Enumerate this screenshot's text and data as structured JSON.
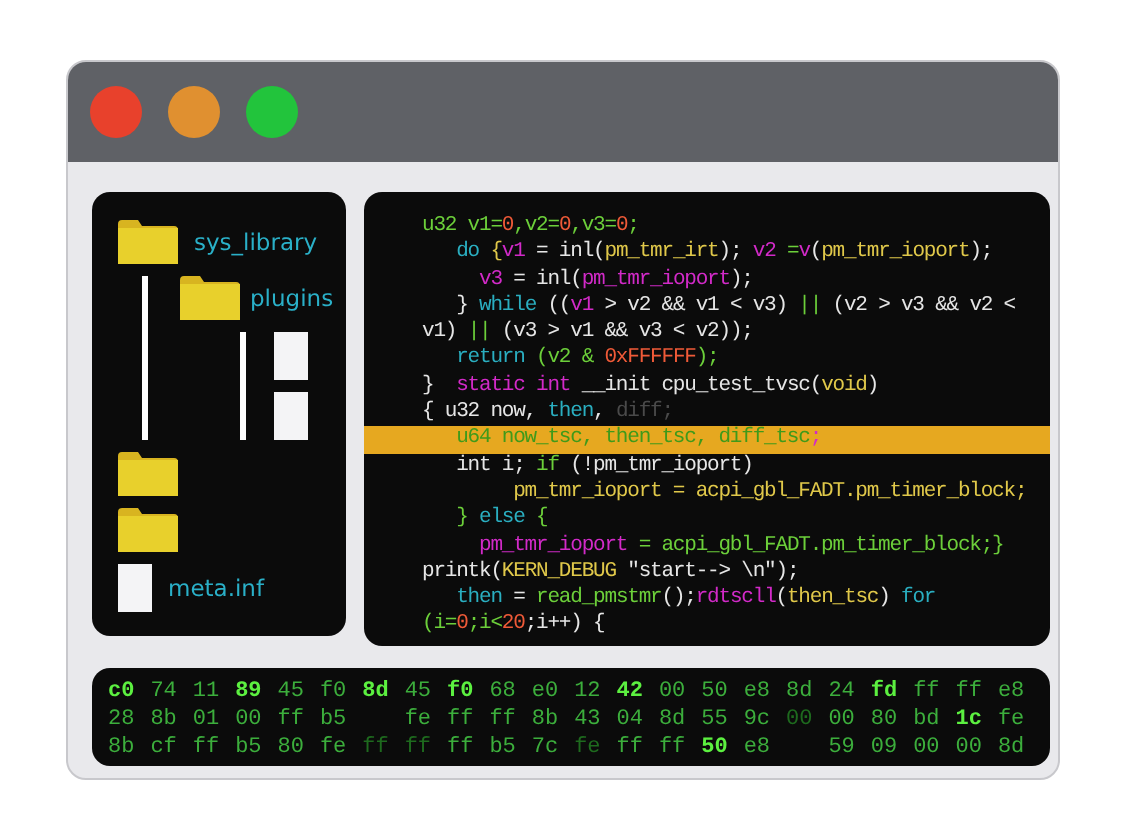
{
  "window": {
    "buttons": [
      {
        "color": "#e8412c"
      },
      {
        "color": "#e09030"
      },
      {
        "color": "#22c43c"
      }
    ]
  },
  "file_tree": [
    {
      "kind": "folder",
      "label": "sys_library",
      "children": [
        {
          "kind": "folder",
          "label": "plugins",
          "children": [
            {
              "kind": "file"
            },
            {
              "kind": "file"
            }
          ]
        }
      ]
    },
    {
      "kind": "folder"
    },
    {
      "kind": "folder"
    },
    {
      "kind": "file",
      "label": "meta.inf"
    }
  ],
  "code_lines": [
    {
      "highlighted": false,
      "tokens": [
        {
          "text": "u32 v1=",
          "color": "#6ccf3a"
        },
        {
          "text": "0",
          "color": "#ef5a38"
        },
        {
          "text": ",v2=",
          "color": "#6ccf3a"
        },
        {
          "text": "0",
          "color": "#ef5a38"
        },
        {
          "text": ",v3=",
          "color": "#6ccf3a"
        },
        {
          "text": "0",
          "color": "#ef5a38"
        },
        {
          "text": ";",
          "color": "#6ccf3a"
        }
      ]
    },
    {
      "highlighted": false,
      "tokens": [
        {
          "text": "   do ",
          "color": "#2aaec0"
        },
        {
          "text": "{",
          "color": "#e0c84a"
        },
        {
          "text": "v1",
          "color": "#d22ac8"
        },
        {
          "text": " = inl(",
          "color": "#e6e6e6"
        },
        {
          "text": "pm_tmr_irt",
          "color": "#e0c84a"
        },
        {
          "text": "); ",
          "color": "#e6e6e6"
        },
        {
          "text": "v2",
          "color": "#d22ac8"
        },
        {
          "text": " =",
          "color": "#6ccf3a"
        },
        {
          "text": "v",
          "color": "#d22ac8"
        },
        {
          "text": "(",
          "color": "#e6e6e6"
        },
        {
          "text": "pm_tmr_ioport",
          "color": "#e0c84a"
        },
        {
          "text": ");",
          "color": "#e6e6e6"
        }
      ]
    },
    {
      "highlighted": false,
      "tokens": [
        {
          "text": "     v3",
          "color": "#d22ac8"
        },
        {
          "text": " = inl(",
          "color": "#e6e6e6"
        },
        {
          "text": "pm_tmr_ioport",
          "color": "#d22ac8"
        },
        {
          "text": ");",
          "color": "#e6e6e6"
        }
      ]
    },
    {
      "highlighted": false,
      "tokens": [
        {
          "text": "   } ",
          "color": "#e6e6e6"
        },
        {
          "text": "while",
          "color": "#2aaec0"
        },
        {
          "text": " ((",
          "color": "#e6e6e6"
        },
        {
          "text": "v1",
          "color": "#d22ac8"
        },
        {
          "text": " > v2 && v1 < v3) ",
          "color": "#e6e6e6"
        },
        {
          "text": "||",
          "color": "#6ccf3a"
        },
        {
          "text": " (v2 > v3 && v2 <",
          "color": "#e6e6e6"
        }
      ]
    },
    {
      "highlighted": false,
      "tokens": [
        {
          "text": "v1) ",
          "color": "#e6e6e6"
        },
        {
          "text": "||",
          "color": "#6ccf3a"
        },
        {
          "text": " (v3 > v1 && v3 < v2));",
          "color": "#e6e6e6"
        }
      ]
    },
    {
      "highlighted": false,
      "tokens": [
        {
          "text": "   return",
          "color": "#2aaec0"
        },
        {
          "text": " (v2 & ",
          "color": "#6ccf3a"
        },
        {
          "text": "0xFFFFFF",
          "color": "#ef5a38"
        },
        {
          "text": ");",
          "color": "#6ccf3a"
        }
      ]
    },
    {
      "highlighted": false,
      "tokens": [
        {
          "text": "}  ",
          "color": "#e6e6e6"
        },
        {
          "text": "static int",
          "color": "#d22ac8"
        },
        {
          "text": " __init cpu_test_tvsc(",
          "color": "#e6e6e6"
        },
        {
          "text": "void",
          "color": "#e0c84a"
        },
        {
          "text": ")",
          "color": "#e6e6e6"
        }
      ]
    },
    {
      "highlighted": false,
      "tokens": [
        {
          "text": "{ u32 now, ",
          "color": "#e6e6e6"
        },
        {
          "text": "then",
          "color": "#2aaec0"
        },
        {
          "text": ", ",
          "color": "#e6e6e6"
        },
        {
          "text": "diff;",
          "color": "#4a4a4a"
        }
      ]
    },
    {
      "highlighted": true,
      "tokens": [
        {
          "text": "   u64 now_tsc, then_tsc, diff_tsc",
          "color": "#3f9a1a"
        },
        {
          "text": ";",
          "color": "#d22ac8"
        }
      ]
    },
    {
      "highlighted": false,
      "tokens": [
        {
          "text": "   int i; ",
          "color": "#e6e6e6"
        },
        {
          "text": "if",
          "color": "#6ccf3a"
        },
        {
          "text": " (!pm_tmr_ioport)",
          "color": "#e6e6e6"
        }
      ]
    },
    {
      "highlighted": false,
      "tokens": [
        {
          "text": "        pm_tmr_ioport = acpi_gbl_FADT.pm_timer_block;",
          "color": "#e0c84a"
        }
      ]
    },
    {
      "highlighted": false,
      "tokens": [
        {
          "text": "   } ",
          "color": "#6ccf3a"
        },
        {
          "text": "else",
          "color": "#2aaec0"
        },
        {
          "text": " {",
          "color": "#6ccf3a"
        }
      ]
    },
    {
      "highlighted": false,
      "tokens": [
        {
          "text": "     pm_tmr_ioport",
          "color": "#d22ac8"
        },
        {
          "text": " = acpi_gbl_FADT.pm_timer_block;}",
          "color": "#6ccf3a"
        }
      ]
    },
    {
      "highlighted": false,
      "tokens": [
        {
          "text": "printk(",
          "color": "#e6e6e6"
        },
        {
          "text": "KERN_DEBUG",
          "color": "#e0c84a"
        },
        {
          "text": " \"start--> \\n\");",
          "color": "#e6e6e6"
        }
      ]
    },
    {
      "highlighted": false,
      "tokens": [
        {
          "text": "   then",
          "color": "#2aaec0"
        },
        {
          "text": " = ",
          "color": "#e6e6e6"
        },
        {
          "text": "read_pmstmr",
          "color": "#6ccf3a"
        },
        {
          "text": "();",
          "color": "#e6e6e6"
        },
        {
          "text": "rdtscll",
          "color": "#d22ac8"
        },
        {
          "text": "(",
          "color": "#e6e6e6"
        },
        {
          "text": "then_tsc",
          "color": "#e0c84a"
        },
        {
          "text": ") ",
          "color": "#e6e6e6"
        },
        {
          "text": "for",
          "color": "#2aaec0"
        }
      ]
    },
    {
      "highlighted": false,
      "tokens": [
        {
          "text": "(i=",
          "color": "#6ccf3a"
        },
        {
          "text": "0",
          "color": "#ef5a38"
        },
        {
          "text": ";i<",
          "color": "#6ccf3a"
        },
        {
          "text": "20",
          "color": "#ef5a38"
        },
        {
          "text": ";i++) {",
          "color": "#e6e6e6"
        }
      ]
    }
  ],
  "hex_rows": [
    [
      {
        "text": "c0",
        "kind": "bright"
      },
      {
        "text": "74",
        "kind": "normal"
      },
      {
        "text": "11",
        "kind": "normal"
      },
      {
        "text": "89",
        "kind": "bright"
      },
      {
        "text": "45",
        "kind": "normal"
      },
      {
        "text": "f0",
        "kind": "normal"
      },
      {
        "text": "8d",
        "kind": "bright"
      },
      {
        "text": "45",
        "kind": "normal"
      },
      {
        "text": "f0",
        "kind": "bright"
      },
      {
        "text": "68",
        "kind": "normal"
      },
      {
        "text": "e0",
        "kind": "normal"
      },
      {
        "text": "12",
        "kind": "normal"
      },
      {
        "text": "42",
        "kind": "bright"
      },
      {
        "text": "00",
        "kind": "normal"
      },
      {
        "text": "50",
        "kind": "normal"
      },
      {
        "text": "e8",
        "kind": "normal"
      },
      {
        "text": "8d",
        "kind": "normal"
      },
      {
        "text": "24",
        "kind": "normal"
      },
      {
        "text": "fd",
        "kind": "bright"
      },
      {
        "text": "ff",
        "kind": "normal"
      },
      {
        "text": "ff",
        "kind": "normal"
      },
      {
        "text": "e8",
        "kind": "normal"
      }
    ],
    [
      {
        "text": "28",
        "kind": "normal"
      },
      {
        "text": "8b",
        "kind": "normal"
      },
      {
        "text": "01",
        "kind": "normal"
      },
      {
        "text": "00",
        "kind": "normal"
      },
      {
        "text": "ff",
        "kind": "normal"
      },
      {
        "text": "b5",
        "kind": "normal"
      },
      {
        "kind": "gap"
      },
      {
        "text": "fe",
        "kind": "normal"
      },
      {
        "text": "ff",
        "kind": "normal"
      },
      {
        "text": "ff",
        "kind": "normal"
      },
      {
        "text": "8b",
        "kind": "normal"
      },
      {
        "text": "43",
        "kind": "normal"
      },
      {
        "text": "04",
        "kind": "normal"
      },
      {
        "text": "8d",
        "kind": "normal"
      },
      {
        "text": "55",
        "kind": "normal"
      },
      {
        "text": "9c",
        "kind": "normal"
      },
      {
        "text": "00",
        "kind": "dim"
      },
      {
        "text": "00",
        "kind": "normal"
      },
      {
        "text": "80",
        "kind": "normal"
      },
      {
        "text": "bd",
        "kind": "normal"
      },
      {
        "text": "1c",
        "kind": "bright"
      },
      {
        "text": "fe",
        "kind": "normal"
      }
    ],
    [
      {
        "text": "8b",
        "kind": "normal"
      },
      {
        "text": "cf",
        "kind": "normal"
      },
      {
        "text": "ff",
        "kind": "normal"
      },
      {
        "text": "b5",
        "kind": "normal"
      },
      {
        "text": "80",
        "kind": "normal"
      },
      {
        "text": "fe",
        "kind": "normal"
      },
      {
        "text": "ff",
        "kind": "dim"
      },
      {
        "text": "ff",
        "kind": "dim"
      },
      {
        "text": "ff",
        "kind": "normal"
      },
      {
        "text": "b5",
        "kind": "normal"
      },
      {
        "text": "7c",
        "kind": "normal"
      },
      {
        "text": "fe",
        "kind": "dim"
      },
      {
        "text": "ff",
        "kind": "normal"
      },
      {
        "text": "ff",
        "kind": "normal"
      },
      {
        "text": "50",
        "kind": "bright"
      },
      {
        "text": "e8",
        "kind": "normal"
      },
      {
        "kind": "gap"
      },
      {
        "text": "59",
        "kind": "normal"
      },
      {
        "text": "09",
        "kind": "normal"
      },
      {
        "text": "00",
        "kind": "normal"
      },
      {
        "text": "00",
        "kind": "normal"
      },
      {
        "text": "8d",
        "kind": "normal"
      }
    ]
  ]
}
